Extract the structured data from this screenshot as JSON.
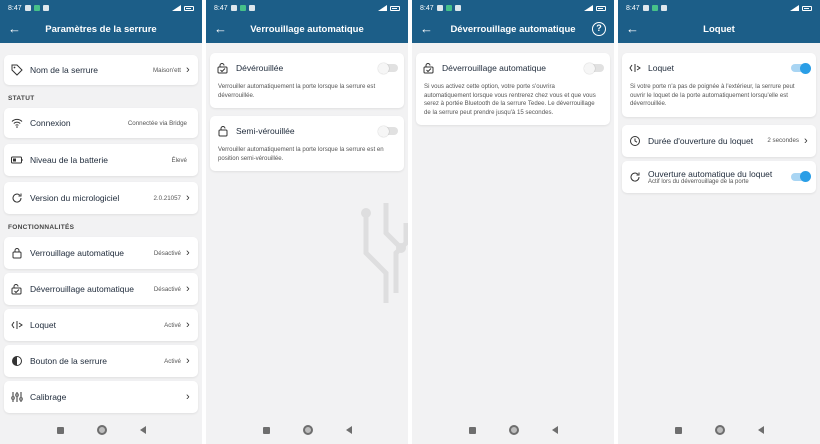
{
  "status": {
    "time": "8:47"
  },
  "colors": {
    "appbar": "#1c5e88",
    "accent": "#2a9ee6"
  },
  "screen1": {
    "title": "Paramètres de la serrure",
    "name_row": {
      "label": "Nom de la serrure",
      "value": "Maison'ett"
    },
    "section_statut": "STATUT",
    "connexion": {
      "label": "Connexion",
      "value": "Connectée via Bridge"
    },
    "battery": {
      "label": "Niveau de la batterie",
      "value": "Élevé"
    },
    "firmware": {
      "label": "Version du micrologiciel",
      "value": "2.0.21057"
    },
    "section_fonctions": "FONCTIONNALITÉS",
    "auto_lock": {
      "label": "Verrouillage automatique",
      "value": "Désactivé"
    },
    "auto_unlock": {
      "label": "Déverrouillage automatique",
      "value": "Désactivé"
    },
    "latch": {
      "label": "Loquet",
      "value": "Activé"
    },
    "button": {
      "label": "Bouton de la serrure",
      "value": "Activé"
    },
    "calibration": {
      "label": "Calibrage"
    }
  },
  "screen2": {
    "title": "Verrouillage automatique",
    "unlocked": {
      "label": "Dévérouillée",
      "desc": "Verrouiller automatiquement la porte lorsque la serrure est déverrouillée."
    },
    "semi": {
      "label": "Semi-vérouillée",
      "desc": "Verrouiller automatiquement la porte lorsque la serrure est en position semi-vérouillée."
    }
  },
  "screen3": {
    "title": "Déverrouillage automatique",
    "help_label": "?",
    "auto_unlock": {
      "label": "Déverrouillage automatique",
      "desc": "Si vous activez cette option, votre porte s'ouvrira automatiquement lorsque vous rentrerez chez vous et que vous serez à portée Bluetooth de la serrure Tedee. Le déverrouillage de la serrure peut prendre jusqu'à 15 secondes."
    }
  },
  "screen4": {
    "title": "Loquet",
    "latch": {
      "label": "Loquet",
      "desc": "Si votre porte n'a pas de poignée à l'extérieur, la serrure peut ouvrir le loquet de la porte automatiquement lorsqu'elle est déverrouillée."
    },
    "duration": {
      "label": "Durée d'ouverture du loquet",
      "value": "2 secondes"
    },
    "auto_open": {
      "label": "Ouverture automatique du loquet",
      "sublabel": "Actif lors du déverrouillage de la porte"
    }
  }
}
